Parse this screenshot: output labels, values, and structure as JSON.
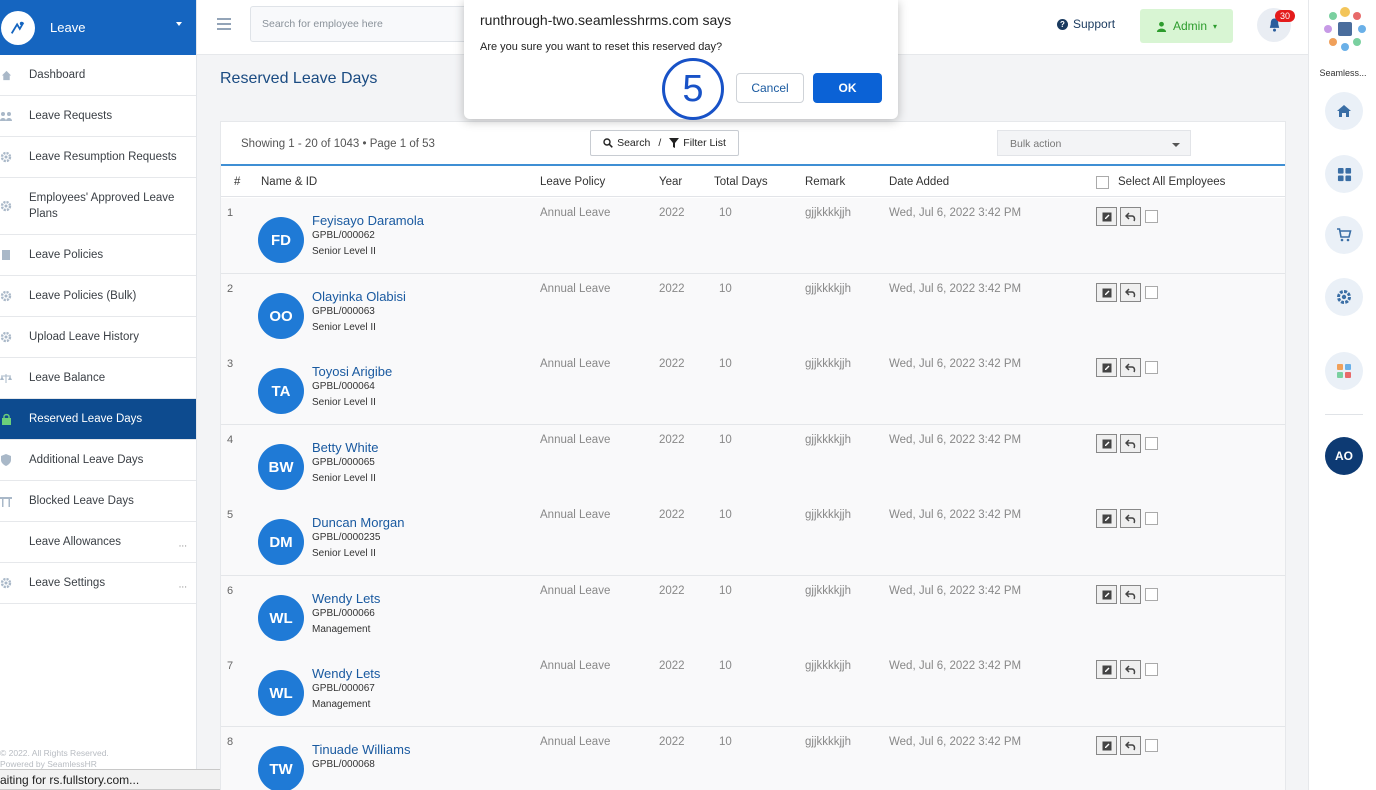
{
  "sidebar": {
    "title": "Leave",
    "items": [
      {
        "label": "Dashboard",
        "icon": "home-icon"
      },
      {
        "label": "Leave Requests",
        "icon": "users-icon"
      },
      {
        "label": "Leave Resumption Requests",
        "icon": "gear-icon"
      },
      {
        "label": "Employees' Approved Leave Plans",
        "icon": "gear-icon"
      },
      {
        "label": "Leave Policies",
        "icon": "document-icon"
      },
      {
        "label": "Leave Policies (Bulk)",
        "icon": "gear-icon"
      },
      {
        "label": "Upload Leave History",
        "icon": "gear-icon"
      },
      {
        "label": "Leave Balance",
        "icon": "scale-icon"
      },
      {
        "label": "Reserved Leave Days",
        "icon": "lock-icon",
        "active": true
      },
      {
        "label": "Additional Leave Days",
        "icon": "shield-icon"
      },
      {
        "label": "Blocked Leave Days",
        "icon": "gate-icon"
      },
      {
        "label": "Leave Allowances",
        "icon": "",
        "more": "..."
      },
      {
        "label": "Leave Settings",
        "icon": "gear-icon",
        "more": "..."
      }
    ],
    "footer_line1": "© 2022. All Rights Reserved.",
    "footer_line2": "Powered by SeamlessHR"
  },
  "statusbar": {
    "text": "aiting for rs.fullstory.com..."
  },
  "topbar": {
    "search_placeholder": "Search for employee here",
    "support_label": "Support",
    "admin_label": "Admin",
    "notification_count": "30"
  },
  "rail": {
    "label": "Seamless...",
    "avatar_initials": "AO"
  },
  "main": {
    "page_title": "Reserved Leave Days",
    "showing": "Showing 1 - 20 of 1043 • Page 1 of 53",
    "search_label": "Search",
    "filter_separator": "/",
    "filter_label": "Filter List",
    "bulk_action": "Bulk action",
    "columns": [
      "#",
      "Name & ID",
      "Leave Policy",
      "Year",
      "Total Days",
      "Remark",
      "Date Added",
      "Select All Employees"
    ],
    "rows": [
      {
        "num": "1",
        "initials": "FD",
        "name": "Feyisayo Daramola",
        "id": "GPBL/000062",
        "level": "Senior Level II",
        "policy": "Annual Leave",
        "year": "2022",
        "days": "10",
        "remark": "gjjkkkkjjh",
        "date": "Wed, Jul 6, 2022 3:42 PM"
      },
      {
        "num": "2",
        "initials": "OO",
        "name": "Olayinka Olabisi",
        "id": "GPBL/000063",
        "level": "Senior Level II",
        "policy": "Annual Leave",
        "year": "2022",
        "days": "10",
        "remark": "gjjkkkkjjh",
        "date": "Wed, Jul 6, 2022 3:42 PM"
      },
      {
        "num": "3",
        "initials": "TA",
        "name": "Toyosi Arigibe",
        "id": "GPBL/000064",
        "level": "Senior Level II",
        "policy": "Annual Leave",
        "year": "2022",
        "days": "10",
        "remark": "gjjkkkkjjh",
        "date": "Wed, Jul 6, 2022 3:42 PM"
      },
      {
        "num": "4",
        "initials": "BW",
        "name": "Betty White",
        "id": "GPBL/000065",
        "level": "Senior Level II",
        "policy": "Annual Leave",
        "year": "2022",
        "days": "10",
        "remark": "gjjkkkkjjh",
        "date": "Wed, Jul 6, 2022 3:42 PM"
      },
      {
        "num": "5",
        "initials": "DM",
        "name": "Duncan Morgan",
        "id": "GPBL/0000235",
        "level": "Senior Level II",
        "policy": "Annual Leave",
        "year": "2022",
        "days": "10",
        "remark": "gjjkkkkjjh",
        "date": "Wed, Jul 6, 2022 3:42 PM"
      },
      {
        "num": "6",
        "initials": "WL",
        "name": "Wendy Lets",
        "id": "GPBL/000066",
        "level": "Management",
        "policy": "Annual Leave",
        "year": "2022",
        "days": "10",
        "remark": "gjjkkkkjjh",
        "date": "Wed, Jul 6, 2022 3:42 PM"
      },
      {
        "num": "7",
        "initials": "WL",
        "name": "Wendy Lets",
        "id": "GPBL/000067",
        "level": "Management",
        "policy": "Annual Leave",
        "year": "2022",
        "days": "10",
        "remark": "gjjkkkkjjh",
        "date": "Wed, Jul 6, 2022 3:42 PM"
      },
      {
        "num": "8",
        "initials": "TW",
        "name": "Tinuade Williams",
        "id": "GPBL/000068",
        "level": "",
        "policy": "Annual Leave",
        "year": "2022",
        "days": "10",
        "remark": "gjjkkkkjjh",
        "date": "Wed, Jul 6, 2022 3:42 PM"
      }
    ]
  },
  "dialog": {
    "title": "runthrough-two.seamlesshrms.com says",
    "message": "Are you sure you want to reset this reserved day?",
    "cancel_label": "Cancel",
    "ok_label": "OK"
  },
  "annotation": {
    "step": "5"
  },
  "colors": {
    "primary": "#1565c0",
    "active_nav": "#0d4b8f",
    "avatar": "#1f7ad6",
    "ok_button": "#0b62d6",
    "badge": "#e41b1b"
  }
}
